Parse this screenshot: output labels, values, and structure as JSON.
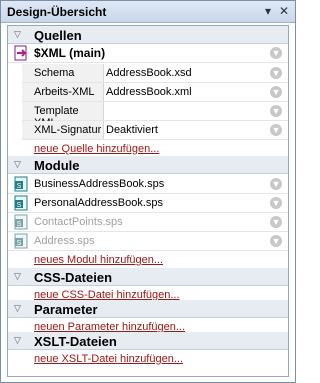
{
  "window": {
    "title": "Design-Übersicht",
    "pin_icon": "pin-icon",
    "close_icon": "close-icon"
  },
  "sections": {
    "sources": {
      "label": "Quellen",
      "add_link": "neue Quelle hinzufügen..."
    },
    "modules": {
      "label": "Module",
      "add_link": "neues Modul hinzufügen..."
    },
    "css": {
      "label": "CSS-Dateien",
      "add_link": "neue CSS-Datei hinzufügen..."
    },
    "params": {
      "label": "Parameter",
      "add_link": "neuen Parameter hinzufügen..."
    },
    "xslt": {
      "label": "XSLT-Dateien",
      "add_link": "neue XSLT-Datei hinzufügen..."
    }
  },
  "source_main": {
    "label": "$XML (main)"
  },
  "source_props": [
    {
      "key": "Schema",
      "value": "AddressBook.xsd",
      "has_button": true
    },
    {
      "key": "Arbeits-XML",
      "value": "AddressBook.xml",
      "has_button": true
    },
    {
      "key": "Template XML",
      "value": "",
      "has_button": true
    },
    {
      "key": "XML-Signatur",
      "value": "Deaktiviert",
      "has_button": true
    }
  ],
  "modules": [
    {
      "name": "BusinessAddressBook.sps",
      "enabled": true
    },
    {
      "name": "PersonalAddressBook.sps",
      "enabled": true
    },
    {
      "name": "ContactPoints.sps",
      "enabled": false
    },
    {
      "name": "Address.sps",
      "enabled": false
    }
  ]
}
